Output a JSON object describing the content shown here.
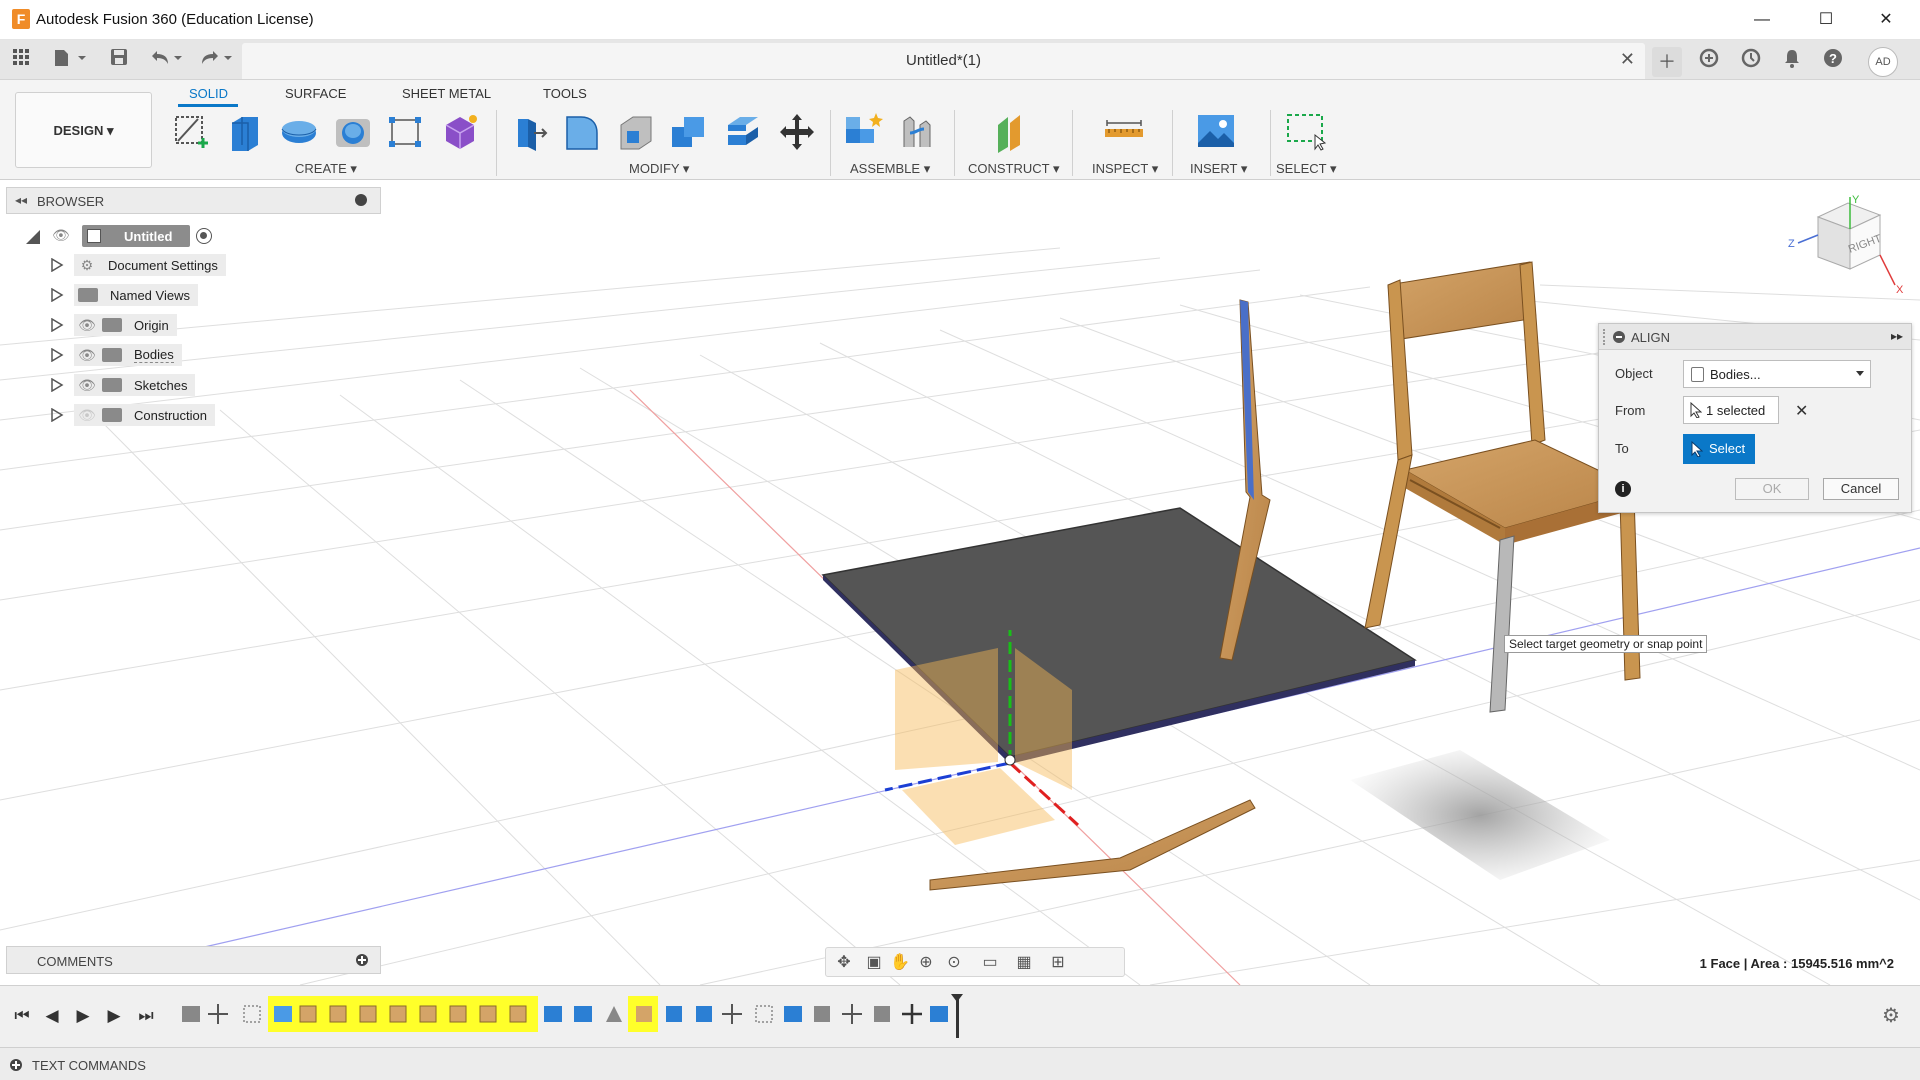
{
  "titlebar": {
    "app_title": "Autodesk Fusion 360 (Education License)",
    "app_icon": "F",
    "minimize": "—",
    "maximize": "☐",
    "close": "✕"
  },
  "qat": {
    "icons": [
      "apps-grid-icon",
      "file-icon",
      "save-icon",
      "undo-icon",
      "redo-icon"
    ],
    "doc_title": "Untitled*(1)",
    "doc_close": "✕",
    "right_icons": [
      "new-tab-icon",
      "extensions-icon",
      "job-status-icon",
      "notifications-icon",
      "help-icon"
    ],
    "user_initials": "AD"
  },
  "ribbon": {
    "tabs": [
      "SOLID",
      "SURFACE",
      "SHEET METAL",
      "TOOLS"
    ],
    "workspace": "DESIGN ▾",
    "groups": [
      "CREATE ▾",
      "MODIFY ▾",
      "ASSEMBLE ▾",
      "CONSTRUCT ▾",
      "INSPECT ▾",
      "INSERT ▾",
      "SELECT ▾"
    ],
    "colors": {
      "accent": "#0a78c8",
      "tool_blue": "#2b7fd4",
      "construct_orange": "#e39a2e",
      "purple": "#8a4fc8"
    }
  },
  "browser": {
    "title": "BROWSER",
    "root": "Untitled",
    "items": [
      {
        "label": "Document Settings",
        "icon": "gear-icon"
      },
      {
        "label": "Named Views",
        "icon": "folder-icon"
      },
      {
        "label": "Origin",
        "icon": "folder-icon"
      },
      {
        "label": "Bodies",
        "icon": "folder-icon"
      },
      {
        "label": "Sketches",
        "icon": "folder-icon"
      },
      {
        "label": "Construction",
        "icon": "folder-icon"
      }
    ]
  },
  "viewcube": {
    "face_label": "RIGHT",
    "axis_y": "Y",
    "axis_z": "Z",
    "axis_x": "X"
  },
  "align_dialog": {
    "title": "ALIGN",
    "object_label": "Object",
    "object_value": "Bodies...",
    "from_label": "From",
    "from_value": "1 selected",
    "to_label": "To",
    "to_value": "Select",
    "ok": "OK",
    "cancel": "Cancel"
  },
  "tooltip": "Select target geometry or snap point",
  "comments": {
    "title": "COMMENTS"
  },
  "status": "1 Face | Area : 15945.516 mm^2",
  "timeline": {
    "controls": [
      "⏮",
      "◀",
      "▶",
      "▶",
      "⏭"
    ]
  },
  "text_commands": {
    "label": "TEXT COMMANDS"
  }
}
